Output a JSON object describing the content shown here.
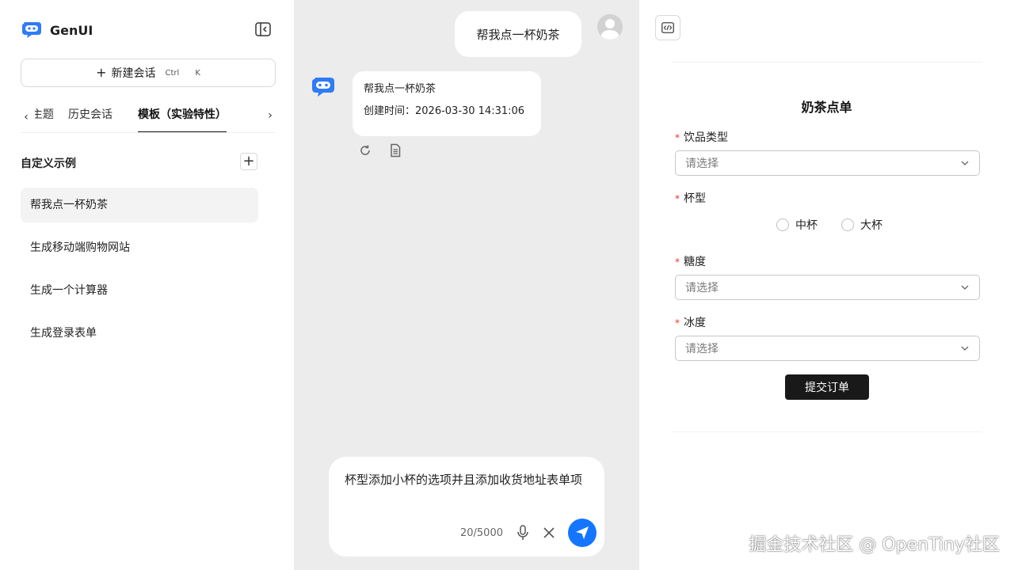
{
  "brand": {
    "name": "GenUI",
    "accent": "#1476ff"
  },
  "sidebar": {
    "new_chat_label": "新建会话",
    "shortcut_ctrl": "Ctrl",
    "shortcut_key": "K",
    "tabs": [
      "主题",
      "历史会话",
      "模板（实验特性）"
    ],
    "active_tab": "模板（实验特性）",
    "section_title": "自定义示例",
    "examples": [
      "帮我点一杯奶茶",
      "生成移动端购物网站",
      "生成一个计算器",
      "生成登录表单"
    ],
    "selected_example": "帮我点一杯奶茶"
  },
  "chat": {
    "user_message": "帮我点一杯奶茶",
    "bot_title": "帮我点一杯奶茶",
    "bot_created": "创建时间：2026-03-30 14:31:06",
    "composer_text": "杯型添加小杯的选项并且添加收货地址表单项",
    "counter": "20/5000"
  },
  "preview": {
    "form_title": "奶茶点单",
    "fields": {
      "drink_type": {
        "label": "饮品类型",
        "placeholder": "请选择"
      },
      "cup_size": {
        "label": "杯型",
        "options": [
          "中杯",
          "大杯"
        ]
      },
      "sugar": {
        "label": "糖度",
        "placeholder": "请选择"
      },
      "ice": {
        "label": "冰度",
        "placeholder": "请选择"
      }
    },
    "submit_label": "提交订单"
  },
  "watermark": "掘金技术社区 @ OpenTiny社区"
}
